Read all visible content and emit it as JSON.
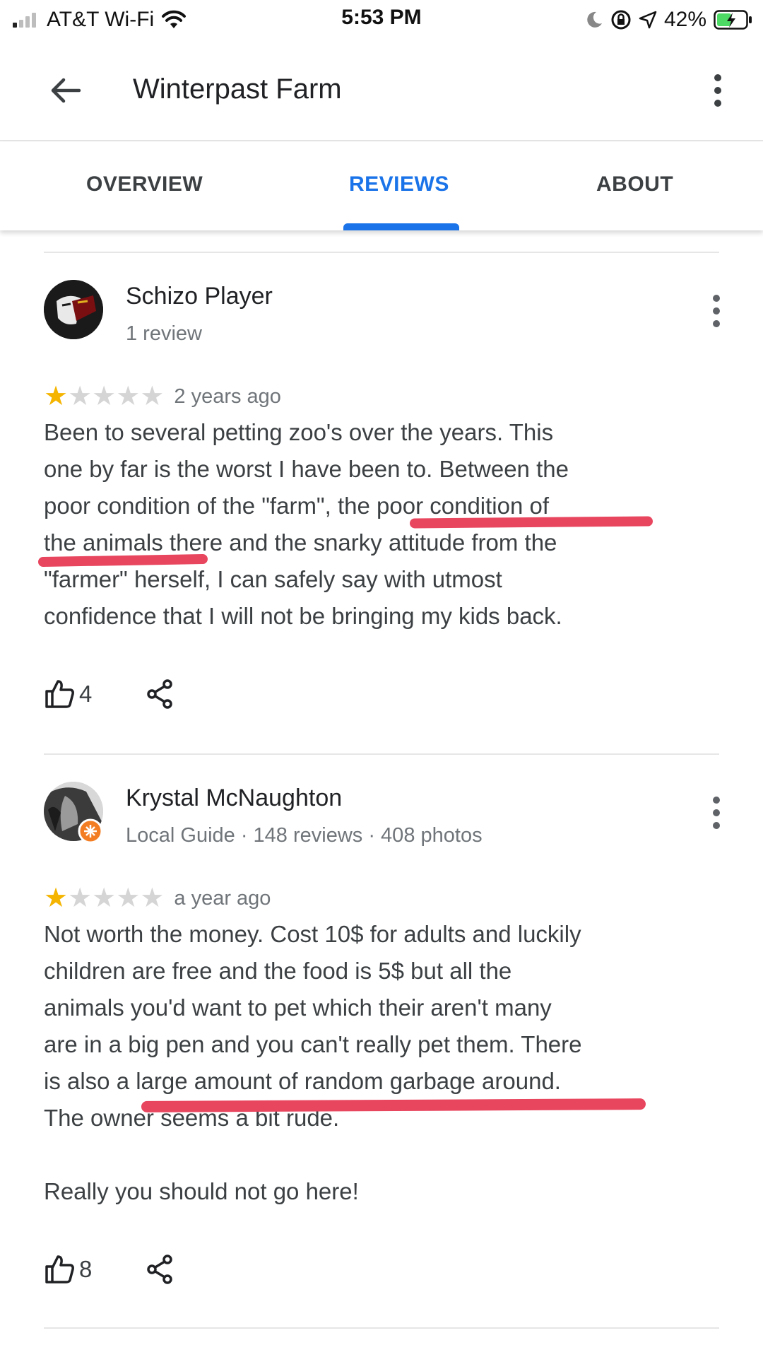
{
  "status_bar": {
    "carrier": "AT&T Wi-Fi",
    "time": "5:53 PM",
    "battery": "42%"
  },
  "header": {
    "title": "Winterpast Farm"
  },
  "tabs": [
    {
      "label": "OVERVIEW"
    },
    {
      "label": "REVIEWS"
    },
    {
      "label": "ABOUT"
    }
  ],
  "colors": {
    "accent": "#1a73e8",
    "star": "#f4b400",
    "highlight_marker": "#e8455e"
  },
  "reviews": [
    {
      "author": "Schizo Player",
      "meta": "1 review",
      "rating": 1,
      "max_rating": 5,
      "age": "2 years ago",
      "lines": [
        "Been to several petting zoo's over the years. This",
        "one by far is the worst I have been to. Between the",
        "poor condition of the \"farm\", the poor condition of",
        "the animals there and the snarky attitude from the",
        "\"farmer\" herself, I can safely say with utmost",
        "confidence that I will not be bringing my kids back."
      ],
      "likes": "4"
    },
    {
      "author": "Krystal McNaughton",
      "meta": "Local Guide · 148 reviews · 408 photos",
      "rating": 1,
      "max_rating": 5,
      "age": "a year ago",
      "lines": [
        "Not worth the money. Cost 10$ for adults and luckily",
        "children are free and the food is 5$ but all the",
        "animals you'd want to pet which their aren't many",
        "are in a big pen and you can't really pet them. There",
        "is also a large amount of random garbage around.",
        "The owner seems a bit rude."
      ],
      "extra": "Really you should not go here!",
      "likes": "8"
    }
  ]
}
